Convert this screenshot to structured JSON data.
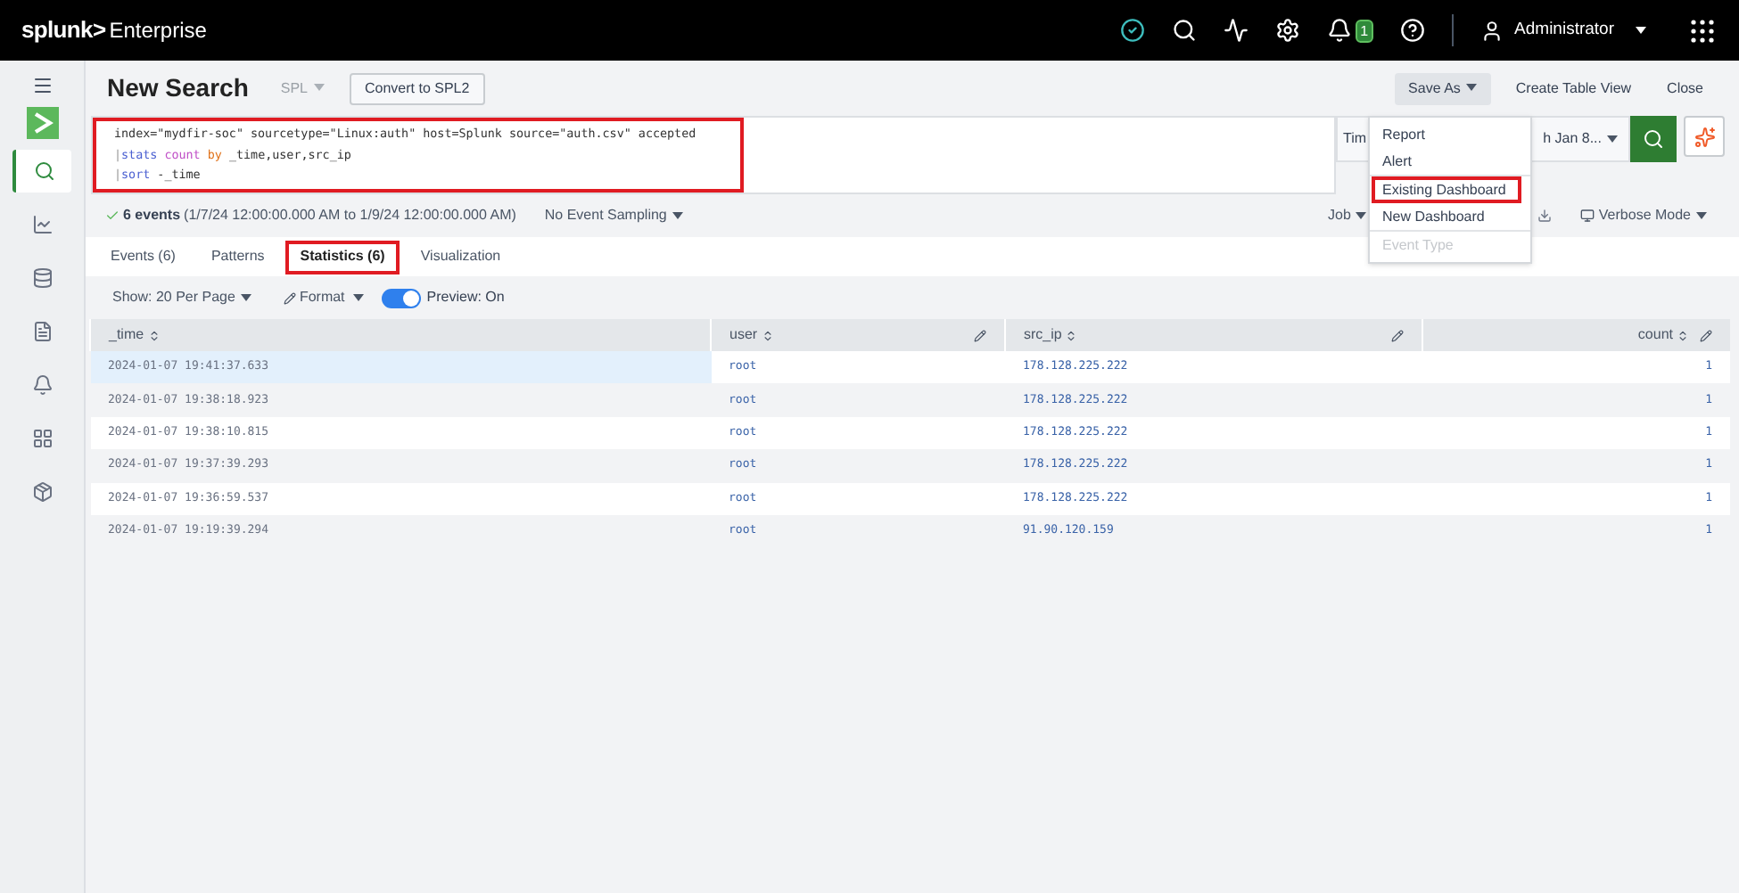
{
  "top_bar": {
    "logo": {
      "brand": "splunk>",
      "product": "Enterprise"
    },
    "notification_count": "1",
    "user": "Administrator"
  },
  "sidebar": {
    "items": [
      {
        "selected": true
      },
      {
        "selected": false
      },
      {
        "selected": false
      },
      {
        "selected": false
      },
      {
        "selected": false
      },
      {
        "selected": false
      },
      {
        "selected": false
      }
    ]
  },
  "header": {
    "title": "New Search",
    "language": "SPL",
    "language_disabled": true,
    "convert_button": "Convert to SPL2",
    "actions": [
      {
        "label": "Save As",
        "kind": "menu",
        "selected": true
      },
      {
        "label": "Create Table View",
        "kind": "link",
        "selected": false
      },
      {
        "label": "Close",
        "kind": "link",
        "selected": false
      }
    ]
  },
  "query": {
    "annotated": true,
    "lines": [
      [
        {
          "text": "index=\"mydfir-soc\" sourcetype=\"Linux:auth\" host=Splunk source=\"auth.csv\" accepted",
          "kind": "plain"
        }
      ],
      [
        {
          "text": "|",
          "kind": "pipe"
        },
        {
          "text": "stats",
          "kind": "command"
        },
        {
          "text": " count",
          "kind": "function"
        },
        {
          "text": " by",
          "kind": "keyword"
        },
        {
          "text": " _time,user,src_ip",
          "kind": "plain"
        }
      ],
      [
        {
          "text": "|",
          "kind": "pipe"
        },
        {
          "text": "sort",
          "kind": "command"
        },
        {
          "text": " -_time",
          "kind": "plain"
        }
      ]
    ]
  },
  "time_picker": {
    "visible_start": "Tim",
    "visible_end": "h Jan 8..."
  },
  "save_as_menu": [
    {
      "label": "Report",
      "disabled": false,
      "annotated": false
    },
    {
      "label": "Alert",
      "disabled": false,
      "annotated": false
    },
    {
      "label": "Existing Dashboard",
      "disabled": false,
      "annotated": true
    },
    {
      "label": "New Dashboard",
      "disabled": false,
      "annotated": false
    },
    {
      "label": "Event Type",
      "disabled": true,
      "annotated": false
    }
  ],
  "status": {
    "events": "6 events",
    "range": "(1/7/24 12:00:00.000 AM to 1/9/24 12:00:00.000 AM)",
    "sampling": "No Event Sampling",
    "job": "Job",
    "mode": "Verbose Mode"
  },
  "tabs": [
    {
      "label": "Events (6)",
      "selected": false,
      "annotated": false
    },
    {
      "label": "Patterns",
      "selected": false,
      "annotated": false
    },
    {
      "label": "Statistics (6)",
      "selected": true,
      "annotated": true
    },
    {
      "label": "Visualization",
      "selected": false,
      "annotated": false
    }
  ],
  "toolbar": {
    "page_size": "Show: 20 Per Page",
    "format": "Format",
    "preview_on": true,
    "preview_label": "Preview: On"
  },
  "table": {
    "columns": [
      {
        "label": "_time",
        "editable": false
      },
      {
        "label": "user",
        "editable": true
      },
      {
        "label": "src_ip",
        "editable": true
      },
      {
        "label": "count",
        "editable": true
      }
    ],
    "rows": [
      {
        "cells": [
          "2024-01-07 19:41:37.633",
          "root",
          "178.128.225.222",
          "1"
        ],
        "hovered": true
      },
      {
        "cells": [
          "2024-01-07 19:38:18.923",
          "root",
          "178.128.225.222",
          "1"
        ],
        "hovered": false
      },
      {
        "cells": [
          "2024-01-07 19:38:10.815",
          "root",
          "178.128.225.222",
          "1"
        ],
        "hovered": false
      },
      {
        "cells": [
          "2024-01-07 19:37:39.293",
          "root",
          "178.128.225.222",
          "1"
        ],
        "hovered": false
      },
      {
        "cells": [
          "2024-01-07 19:36:59.537",
          "root",
          "178.128.225.222",
          "1"
        ],
        "hovered": false
      },
      {
        "cells": [
          "2024-01-07 19:19:39.294",
          "root",
          "91.90.120.159",
          "1"
        ],
        "hovered": false
      }
    ]
  }
}
